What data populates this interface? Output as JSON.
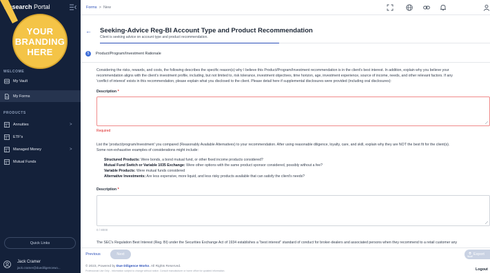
{
  "app": {
    "title_bold": "Research",
    "title_regular": " Portal",
    "badge_lines": [
      "YOUR",
      "BRANDING",
      "HERE"
    ]
  },
  "sidebar": {
    "welcome_label": "WELCOME",
    "welcome_items": [
      {
        "label": "My Vault",
        "icon": "vault-icon"
      },
      {
        "label": "My Forms",
        "icon": "document-icon",
        "active": true
      }
    ],
    "products_label": "PRODUCTS",
    "product_items": [
      {
        "label": "Annuities",
        "icon": "table-icon",
        "has_chevron": true
      },
      {
        "label": "ETF's",
        "icon": "table-icon",
        "has_chevron": false
      },
      {
        "label": "Managed Money",
        "icon": "table-icon",
        "has_chevron": true
      },
      {
        "label": "Mutual Funds",
        "icon": "table-icon",
        "has_chevron": false
      }
    ],
    "chevron": ">",
    "quick_links": "Quick Links",
    "user": {
      "name": "Jack Cramer",
      "email": "jack.cramer@duediligencewo..."
    }
  },
  "breadcrumb": {
    "root": "Forms",
    "separator": ">",
    "current": "New"
  },
  "topbar_icons": [
    "fullscreen-icon",
    "globe-icon",
    "link-icon",
    "bell-icon",
    "user-icon"
  ],
  "header": {
    "back": "←",
    "title": "Seeking-Advice Reg-BI Account Type and Product Recommendation",
    "subtitle": "Client is seeking advice on account type and product recommendation."
  },
  "step": {
    "number": "5",
    "title": "Product/Program/Investment Rationale"
  },
  "section1": {
    "lines": [
      "Considering the risks, rewards, and costs, the following describes the specific reason(s) why I believe this Product/Program/Investment recommendation is in the client's best interest. In addition, explain why you believe your",
      "recommendation aligns with the client's investment profile, including, but not limited to, risk tolerance, investment objectives, time horizon, age, investment experience, source of income, needs, and other relevant factors. If any",
      "'conflict of interest' exists in this recommendation, please explain what you disclosed to the client. Please detail here if supplemental disclosures were provided (including oral disclosures):"
    ],
    "field_label": "Description",
    "required_mark": "*",
    "error": "Required"
  },
  "section2": {
    "lines": [
      "List the 'product/program/investment' you compared (Reasonably Available Alternatives) to your recommendation. After using reasonable diligence, loyalty, care, and skill, explain why they are NOT the best fit for the client(s).",
      "Some non-exhaustive examples of considerations might include:"
    ],
    "bullets": [
      {
        "bold": "Structured Products:",
        "text": " Were bonds, a bond mutual fund, or other fixed income products considered?"
      },
      {
        "bold": "Mutual Fund Switch or Variable 1035 Exchange:",
        "text": " Were other options with the same product sponsor considered, possibly without a fee?"
      },
      {
        "bold": "Variable Products:",
        "text": " Were mutual funds considered"
      },
      {
        "bold": "Alternative Investments:",
        "text": " Are less expensive, more liquid, and less risky products available that can satisfy the client's needs?"
      }
    ],
    "field_label": "Description",
    "required_mark": "*",
    "counter": "0 / 8000"
  },
  "section3": {
    "line": "The SEC's Regulation Best Interest (Reg. BI) under the Securities Exchange Act of 1934 establishes a \"best interest\" standard of conduct for broker-dealers and associated persons when they recommend to a retail customer any"
  },
  "footer": {
    "previous": "Previous",
    "next": "Next",
    "export": "Export",
    "copyright_prefix": "© 2023, Powered by ",
    "copyright_brand": "Due Diligence Works",
    "copyright_suffix": ". All Rights Reserved.",
    "disclaimer": "Professional Use Only - Information subject to change without notice. Consult manufacturer or home office for updated information.",
    "logout": "Logout"
  },
  "colors": {
    "sidebar_bg": "#14213a",
    "accent": "#2b4fb8",
    "badge": "#f4c447",
    "error": "#dc2626"
  }
}
